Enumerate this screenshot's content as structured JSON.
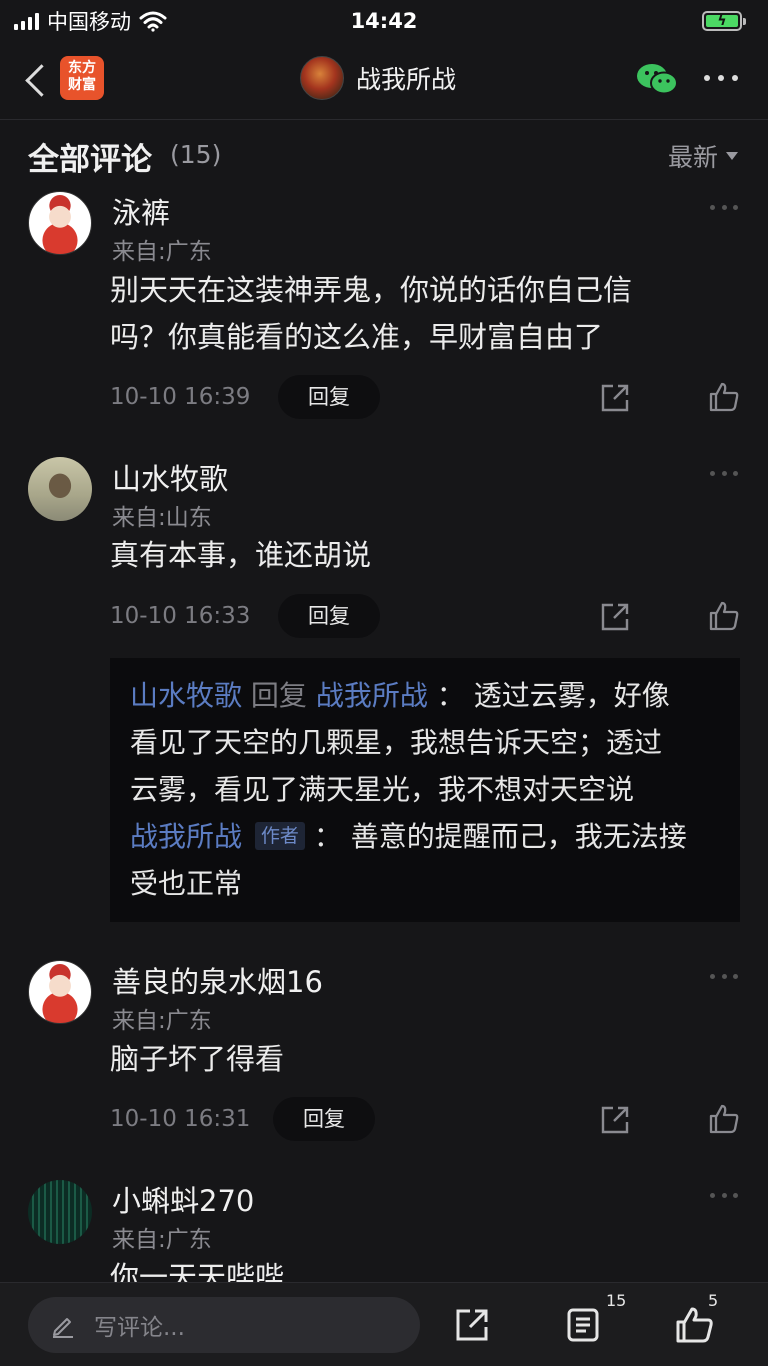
{
  "status_bar": {
    "carrier": "中国移动",
    "time": "14:42"
  },
  "nav": {
    "logo_line1": "东方",
    "logo_line2": "财富",
    "title": "战我所战"
  },
  "section": {
    "title": "全部评论",
    "count": "(15)",
    "sort_label": "最新"
  },
  "comments": [
    {
      "author": "泳裤",
      "location": "来自:广东",
      "text_line1": "别天天在这装神弄鬼，你说的话你自己信",
      "text_line2": "吗？你真能看的这么准，早财富自由了",
      "time": "10-10 16:39",
      "reply_label": "回复"
    },
    {
      "author": "山水牧歌",
      "location": "来自:山东",
      "text_line1": "真有本事，谁还胡说",
      "time": "10-10 16:33",
      "reply_label": "回复"
    },
    {
      "author": "善良的泉水烟16",
      "location": "来自:广东",
      "text_line1": "脑子坏了得看",
      "time": "10-10 16:31",
      "reply_label": "回复"
    },
    {
      "author": "小蝌蚪270",
      "location": "来自:广东",
      "text_line1": "你一天天哔哔"
    }
  ],
  "replies": {
    "reply1_from": "山水牧歌",
    "reply1_verb": "回复",
    "reply1_to": "战我所战",
    "reply1_colon": "：",
    "reply1_text_a": "透过云雾，好像",
    "reply1_text_b": "看见了天空的几颗星，我想告诉天空；透过",
    "reply1_text_c": "云雾，看见了满天星光，我不想对天空说",
    "reply2_from": "战我所战",
    "reply2_tag": "作者",
    "reply2_colon": "：",
    "reply2_text_a": "善意的提醒而己，我无法接",
    "reply2_text_b": "受也正常"
  },
  "bottom_bar": {
    "placeholder": "写评论...",
    "comment_count": "15",
    "like_count": "5"
  }
}
